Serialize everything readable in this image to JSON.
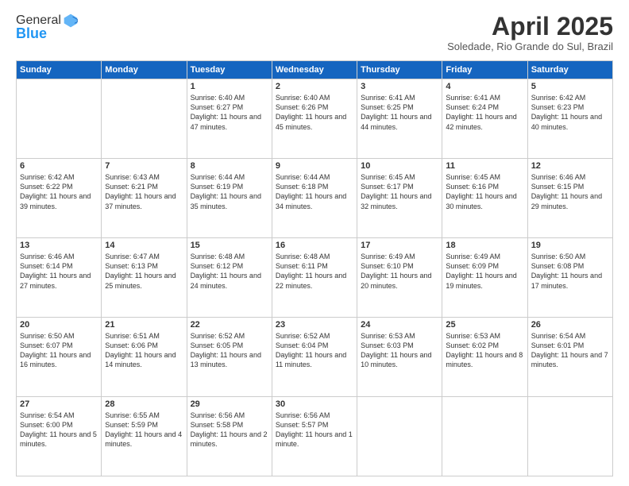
{
  "logo": {
    "line1": "General",
    "line2": "Blue"
  },
  "header": {
    "title": "April 2025",
    "location": "Soledade, Rio Grande do Sul, Brazil"
  },
  "weekdays": [
    "Sunday",
    "Monday",
    "Tuesday",
    "Wednesday",
    "Thursday",
    "Friday",
    "Saturday"
  ],
  "weeks": [
    [
      {
        "day": "",
        "sunrise": "",
        "sunset": "",
        "daylight": ""
      },
      {
        "day": "",
        "sunrise": "",
        "sunset": "",
        "daylight": ""
      },
      {
        "day": "1",
        "sunrise": "Sunrise: 6:40 AM",
        "sunset": "Sunset: 6:27 PM",
        "daylight": "Daylight: 11 hours and 47 minutes."
      },
      {
        "day": "2",
        "sunrise": "Sunrise: 6:40 AM",
        "sunset": "Sunset: 6:26 PM",
        "daylight": "Daylight: 11 hours and 45 minutes."
      },
      {
        "day": "3",
        "sunrise": "Sunrise: 6:41 AM",
        "sunset": "Sunset: 6:25 PM",
        "daylight": "Daylight: 11 hours and 44 minutes."
      },
      {
        "day": "4",
        "sunrise": "Sunrise: 6:41 AM",
        "sunset": "Sunset: 6:24 PM",
        "daylight": "Daylight: 11 hours and 42 minutes."
      },
      {
        "day": "5",
        "sunrise": "Sunrise: 6:42 AM",
        "sunset": "Sunset: 6:23 PM",
        "daylight": "Daylight: 11 hours and 40 minutes."
      }
    ],
    [
      {
        "day": "6",
        "sunrise": "Sunrise: 6:42 AM",
        "sunset": "Sunset: 6:22 PM",
        "daylight": "Daylight: 11 hours and 39 minutes."
      },
      {
        "day": "7",
        "sunrise": "Sunrise: 6:43 AM",
        "sunset": "Sunset: 6:21 PM",
        "daylight": "Daylight: 11 hours and 37 minutes."
      },
      {
        "day": "8",
        "sunrise": "Sunrise: 6:44 AM",
        "sunset": "Sunset: 6:19 PM",
        "daylight": "Daylight: 11 hours and 35 minutes."
      },
      {
        "day": "9",
        "sunrise": "Sunrise: 6:44 AM",
        "sunset": "Sunset: 6:18 PM",
        "daylight": "Daylight: 11 hours and 34 minutes."
      },
      {
        "day": "10",
        "sunrise": "Sunrise: 6:45 AM",
        "sunset": "Sunset: 6:17 PM",
        "daylight": "Daylight: 11 hours and 32 minutes."
      },
      {
        "day": "11",
        "sunrise": "Sunrise: 6:45 AM",
        "sunset": "Sunset: 6:16 PM",
        "daylight": "Daylight: 11 hours and 30 minutes."
      },
      {
        "day": "12",
        "sunrise": "Sunrise: 6:46 AM",
        "sunset": "Sunset: 6:15 PM",
        "daylight": "Daylight: 11 hours and 29 minutes."
      }
    ],
    [
      {
        "day": "13",
        "sunrise": "Sunrise: 6:46 AM",
        "sunset": "Sunset: 6:14 PM",
        "daylight": "Daylight: 11 hours and 27 minutes."
      },
      {
        "day": "14",
        "sunrise": "Sunrise: 6:47 AM",
        "sunset": "Sunset: 6:13 PM",
        "daylight": "Daylight: 11 hours and 25 minutes."
      },
      {
        "day": "15",
        "sunrise": "Sunrise: 6:48 AM",
        "sunset": "Sunset: 6:12 PM",
        "daylight": "Daylight: 11 hours and 24 minutes."
      },
      {
        "day": "16",
        "sunrise": "Sunrise: 6:48 AM",
        "sunset": "Sunset: 6:11 PM",
        "daylight": "Daylight: 11 hours and 22 minutes."
      },
      {
        "day": "17",
        "sunrise": "Sunrise: 6:49 AM",
        "sunset": "Sunset: 6:10 PM",
        "daylight": "Daylight: 11 hours and 20 minutes."
      },
      {
        "day": "18",
        "sunrise": "Sunrise: 6:49 AM",
        "sunset": "Sunset: 6:09 PM",
        "daylight": "Daylight: 11 hours and 19 minutes."
      },
      {
        "day": "19",
        "sunrise": "Sunrise: 6:50 AM",
        "sunset": "Sunset: 6:08 PM",
        "daylight": "Daylight: 11 hours and 17 minutes."
      }
    ],
    [
      {
        "day": "20",
        "sunrise": "Sunrise: 6:50 AM",
        "sunset": "Sunset: 6:07 PM",
        "daylight": "Daylight: 11 hours and 16 minutes."
      },
      {
        "day": "21",
        "sunrise": "Sunrise: 6:51 AM",
        "sunset": "Sunset: 6:06 PM",
        "daylight": "Daylight: 11 hours and 14 minutes."
      },
      {
        "day": "22",
        "sunrise": "Sunrise: 6:52 AM",
        "sunset": "Sunset: 6:05 PM",
        "daylight": "Daylight: 11 hours and 13 minutes."
      },
      {
        "day": "23",
        "sunrise": "Sunrise: 6:52 AM",
        "sunset": "Sunset: 6:04 PM",
        "daylight": "Daylight: 11 hours and 11 minutes."
      },
      {
        "day": "24",
        "sunrise": "Sunrise: 6:53 AM",
        "sunset": "Sunset: 6:03 PM",
        "daylight": "Daylight: 11 hours and 10 minutes."
      },
      {
        "day": "25",
        "sunrise": "Sunrise: 6:53 AM",
        "sunset": "Sunset: 6:02 PM",
        "daylight": "Daylight: 11 hours and 8 minutes."
      },
      {
        "day": "26",
        "sunrise": "Sunrise: 6:54 AM",
        "sunset": "Sunset: 6:01 PM",
        "daylight": "Daylight: 11 hours and 7 minutes."
      }
    ],
    [
      {
        "day": "27",
        "sunrise": "Sunrise: 6:54 AM",
        "sunset": "Sunset: 6:00 PM",
        "daylight": "Daylight: 11 hours and 5 minutes."
      },
      {
        "day": "28",
        "sunrise": "Sunrise: 6:55 AM",
        "sunset": "Sunset: 5:59 PM",
        "daylight": "Daylight: 11 hours and 4 minutes."
      },
      {
        "day": "29",
        "sunrise": "Sunrise: 6:56 AM",
        "sunset": "Sunset: 5:58 PM",
        "daylight": "Daylight: 11 hours and 2 minutes."
      },
      {
        "day": "30",
        "sunrise": "Sunrise: 6:56 AM",
        "sunset": "Sunset: 5:57 PM",
        "daylight": "Daylight: 11 hours and 1 minute."
      },
      {
        "day": "",
        "sunrise": "",
        "sunset": "",
        "daylight": ""
      },
      {
        "day": "",
        "sunrise": "",
        "sunset": "",
        "daylight": ""
      },
      {
        "day": "",
        "sunrise": "",
        "sunset": "",
        "daylight": ""
      }
    ]
  ]
}
